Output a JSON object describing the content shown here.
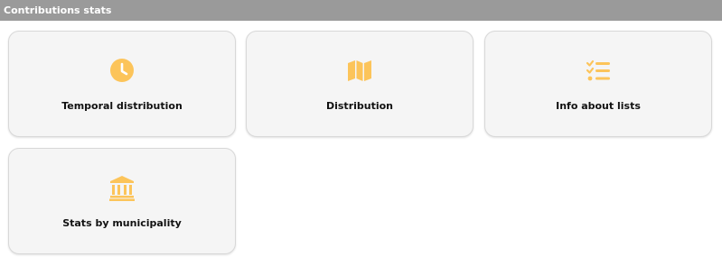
{
  "header": {
    "title": "Contributions stats"
  },
  "accent_color": "#fcc45a",
  "cards": [
    {
      "label": "Temporal distribution",
      "icon": "clock-icon"
    },
    {
      "label": "Distribution",
      "icon": "map-icon"
    },
    {
      "label": "Info about lists",
      "icon": "checklist-icon"
    },
    {
      "label": "Stats by municipality",
      "icon": "government-building-icon"
    }
  ]
}
